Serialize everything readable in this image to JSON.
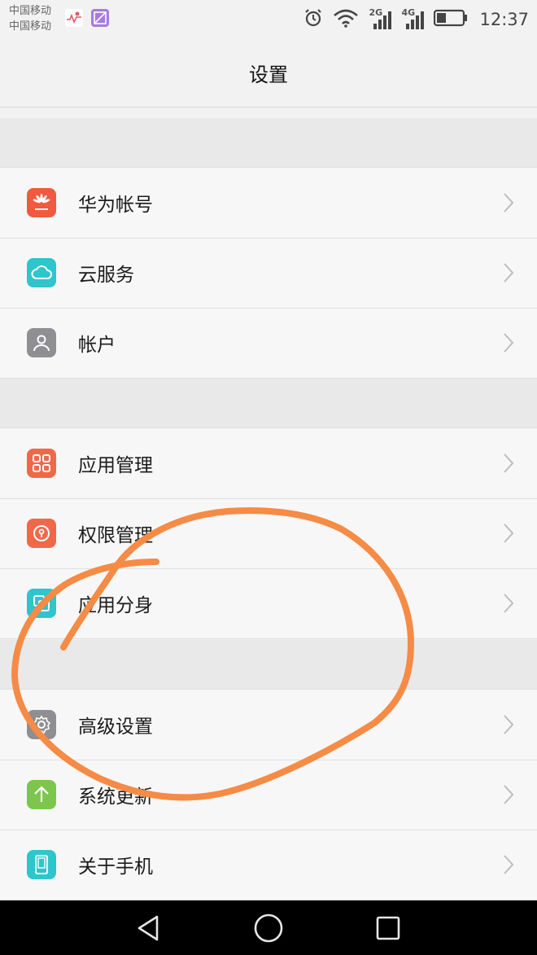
{
  "status_bar": {
    "carrier_1": "中国移动",
    "carrier_2": "中国移动",
    "signal_1_label": "2G",
    "signal_2_label": "4G",
    "time": "12:37",
    "icons": [
      "health-icon",
      "gallery-icon",
      "alarm-icon",
      "wifi-icon",
      "signal-icon",
      "battery-icon"
    ]
  },
  "header": {
    "title": "设置"
  },
  "groups": [
    {
      "items": [
        {
          "label": "华为帐号",
          "icon": "huawei-logo-icon",
          "color": "#f05a40"
        },
        {
          "label": "云服务",
          "icon": "cloud-icon",
          "color": "#2ec5cc"
        },
        {
          "label": "帐户",
          "icon": "user-icon",
          "color": "#8e8e93"
        }
      ]
    },
    {
      "items": [
        {
          "label": "应用管理",
          "icon": "grid-icon",
          "color": "#f16849"
        },
        {
          "label": "权限管理",
          "icon": "key-icon",
          "color": "#f16849"
        },
        {
          "label": "应用分身",
          "icon": "clone-icon",
          "color": "#2ec5cc"
        }
      ]
    },
    {
      "items": [
        {
          "label": "高级设置",
          "icon": "gear-icon",
          "color": "#8e8e93"
        },
        {
          "label": "系统更新",
          "icon": "arrow-up-icon",
          "color": "#7cc64b"
        },
        {
          "label": "关于手机",
          "icon": "phone-icon",
          "color": "#2ec5cc"
        }
      ]
    }
  ],
  "annotation_color": "#f58b45",
  "nav_bar": {
    "icons": [
      "back-icon",
      "home-icon",
      "recent-apps-icon"
    ]
  }
}
